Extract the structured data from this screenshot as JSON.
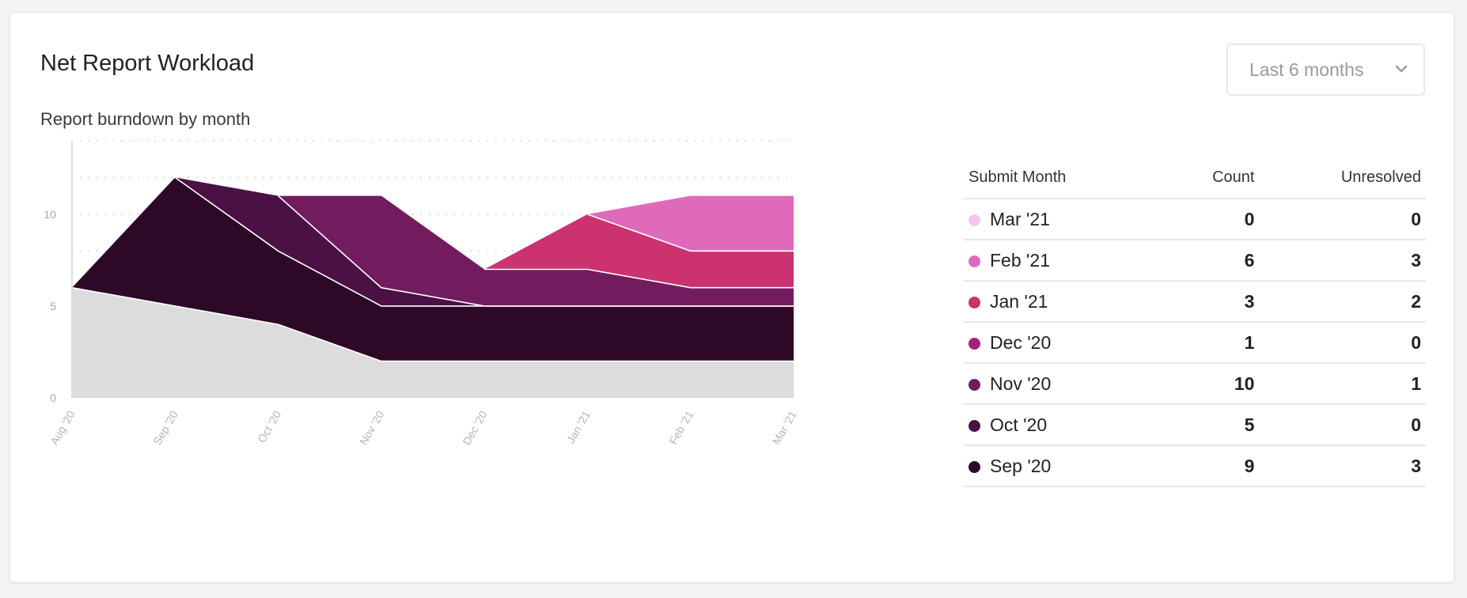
{
  "card": {
    "title": "Net Report Workload",
    "subtitle": "Report burndown by month"
  },
  "period_select": {
    "value": "Last 6 months",
    "icon": "chevron-down-icon"
  },
  "table": {
    "headers": {
      "month": "Submit Month",
      "count": "Count",
      "unresolved": "Unresolved"
    },
    "rows": [
      {
        "month": "Mar '21",
        "count": "0",
        "unresolved": "0",
        "color": "#f6c6ea"
      },
      {
        "month": "Feb '21",
        "count": "6",
        "unresolved": "3",
        "color": "#df6abb"
      },
      {
        "month": "Jan '21",
        "count": "3",
        "unresolved": "2",
        "color": "#cc3270"
      },
      {
        "month": "Dec '20",
        "count": "1",
        "unresolved": "0",
        "color": "#a72077"
      },
      {
        "month": "Nov '20",
        "count": "10",
        "unresolved": "1",
        "color": "#721b5e"
      },
      {
        "month": "Oct '20",
        "count": "5",
        "unresolved": "0",
        "color": "#4b1144"
      },
      {
        "month": "Sep '20",
        "count": "9",
        "unresolved": "3",
        "color": "#2e0827"
      }
    ]
  },
  "chart_data": {
    "type": "area",
    "stacked": true,
    "x": [
      "Aug '20",
      "Sep '20",
      "Oct '20",
      "Nov '20",
      "Dec '20",
      "Jan '21",
      "Feb '21",
      "Mar '21"
    ],
    "yticks": [
      0,
      5,
      10
    ],
    "ylim": [
      0,
      14
    ],
    "grid": "dotted-horizontal",
    "series": [
      {
        "color": "#dcdcdc",
        "values": [
          6,
          5,
          4,
          2,
          2,
          2,
          2,
          2
        ]
      },
      {
        "color": "#2e0827",
        "values": [
          0,
          7,
          4,
          3,
          3,
          3,
          3,
          3
        ]
      },
      {
        "color": "#4b1144",
        "values": [
          null,
          0,
          3,
          1,
          0,
          0,
          0,
          0
        ]
      },
      {
        "color": "#721b5e",
        "values": [
          null,
          null,
          0,
          5,
          2,
          2,
          1,
          1
        ]
      },
      {
        "color": "#cc3270",
        "values": [
          null,
          null,
          null,
          null,
          0,
          3,
          2,
          2
        ]
      },
      {
        "color": "#df6abb",
        "values": [
          null,
          null,
          null,
          null,
          null,
          0,
          3,
          3
        ]
      }
    ]
  }
}
